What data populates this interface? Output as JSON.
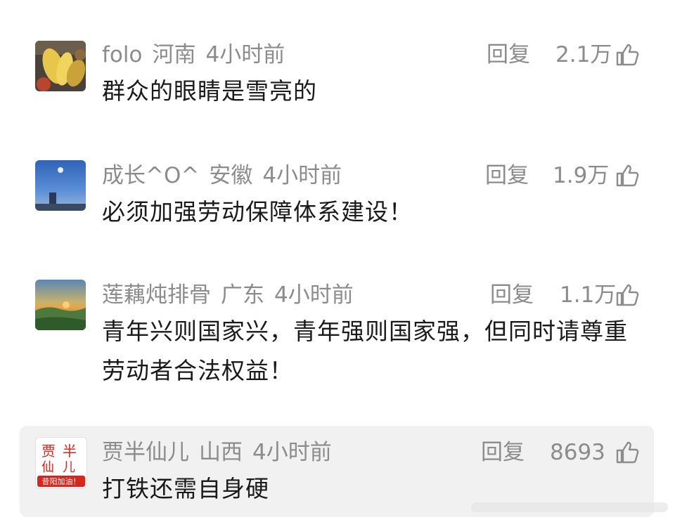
{
  "comments": [
    {
      "username": "folo",
      "location": "河南",
      "time": "4小时前",
      "reply_label": "回复",
      "likes": "2.1万",
      "content": "群众的眼睛是雪亮的",
      "avatar_icon": "fruit-photo-avatar"
    },
    {
      "username": "成长^O^",
      "location": "安徽",
      "time": "4小时前",
      "reply_label": "回复",
      "likes": "1.9万",
      "content": "必须加强劳动保障体系建设！",
      "avatar_icon": "sky-photo-avatar"
    },
    {
      "username": "莲藕炖排骨",
      "location": "广东",
      "time": "4小时前",
      "reply_label": "回复",
      "likes": "1.1万",
      "content": "青年兴则国家兴，青年强则国家强，但同时请尊重劳动者合法权益！",
      "avatar_icon": "landscape-photo-avatar"
    },
    {
      "username": "贾半仙儿",
      "location": "山西",
      "time": "4小时前",
      "reply_label": "回复",
      "likes": "8693",
      "content": "打铁还需自身硬",
      "avatar_icon": "red-seal-avatar",
      "avatar_text": "昔阳加油！"
    }
  ],
  "colors": {
    "meta_text": "#8c8c8c",
    "body_text": "#1a1a1a",
    "highlight_bg": "#f1f1f1",
    "seal_red": "#d9251c"
  }
}
